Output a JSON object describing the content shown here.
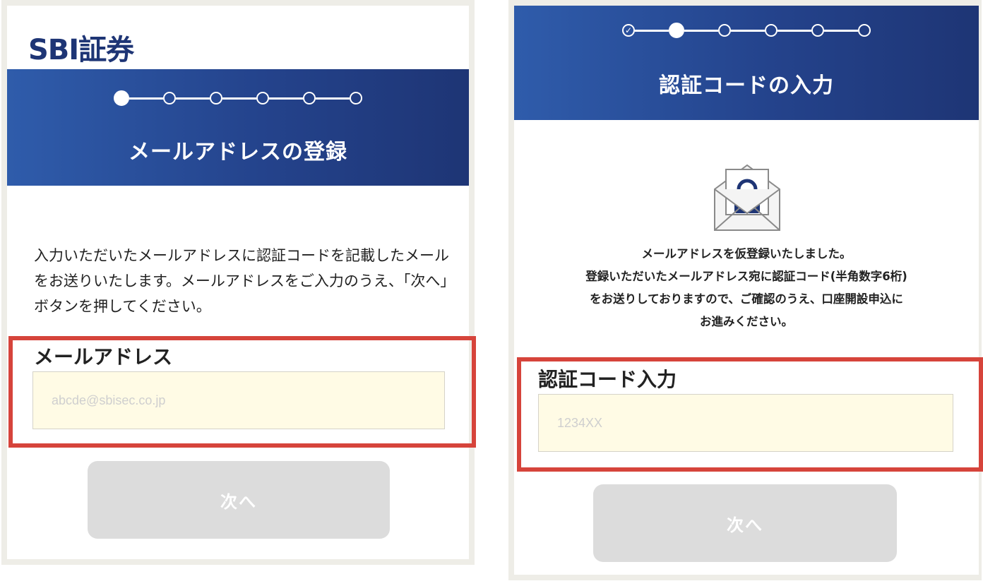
{
  "left_screen": {
    "logo": "SBI証券",
    "stepper": {
      "total": 6,
      "current": 1,
      "completed": 0
    },
    "title": "メールアドレスの登録",
    "description": "入力いただいたメールアドレスに認証コードを記載したメールをお送りいたします。メールアドレスをご入力のうえ、「次へ」ボタンを押してください。",
    "field_label": "メールアドレス",
    "input_placeholder": "abcde@sbisec.co.jp",
    "input_value": "",
    "next_button": "次へ"
  },
  "right_screen": {
    "stepper": {
      "total": 6,
      "current": 2,
      "completed": 1
    },
    "title": "認証コードの入力",
    "icon": "lock-envelope-icon",
    "message_lines": [
      "メールアドレスを仮登録いたしました。",
      "登録いただいたメールアドレス宛に認証コード(半角数字6桁)",
      "をお送りしておりますので、ご確認のうえ、口座開設申込に",
      "お進みください。"
    ],
    "field_label": "認証コード入力",
    "input_placeholder": "1234XX",
    "input_value": "",
    "next_button": "次へ"
  },
  "colors": {
    "header_gradient_start": "#2f5cab",
    "header_gradient_end": "#1e3575",
    "logo": "#1e3575",
    "highlight_border": "#d6443b",
    "input_background": "#fffbe5",
    "button_disabled": "#dcdcdc"
  }
}
